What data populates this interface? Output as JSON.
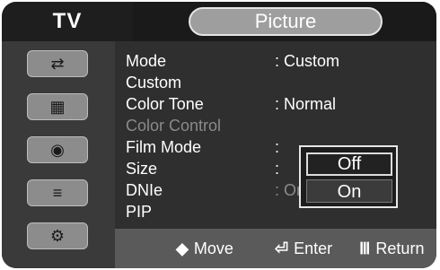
{
  "header": {
    "tv_label": "TV",
    "title": "Picture"
  },
  "sidebar": {
    "icons": [
      {
        "name": "input-icon",
        "glyph": "⇄"
      },
      {
        "name": "picture-icon",
        "glyph": "▦"
      },
      {
        "name": "sound-icon",
        "glyph": "◉"
      },
      {
        "name": "channel-icon",
        "glyph": "≡"
      },
      {
        "name": "setup-icon",
        "glyph": "⚙"
      }
    ]
  },
  "menu": {
    "items": [
      {
        "label": "Mode",
        "value": ": Custom",
        "enabled": true
      },
      {
        "label": "Custom",
        "value": "",
        "enabled": true
      },
      {
        "label": "Color Tone",
        "value": ": Normal",
        "enabled": true
      },
      {
        "label": "Color Control",
        "value": "",
        "enabled": false
      },
      {
        "label": "Film Mode",
        "value": ":",
        "enabled": true
      },
      {
        "label": "Size",
        "value": ":",
        "enabled": true
      },
      {
        "label": "DNIe",
        "value": ": On",
        "enabled": true
      },
      {
        "label": "PIP",
        "value": "",
        "enabled": true
      }
    ]
  },
  "dropdown": {
    "options": [
      "Off",
      "On"
    ],
    "selected": "Off"
  },
  "footer": {
    "move_icon": "◆",
    "move_label": "Move",
    "enter_icon": "⏎",
    "enter_label": "Enter",
    "return_icon": "Ⅲ",
    "return_label": "Return"
  }
}
